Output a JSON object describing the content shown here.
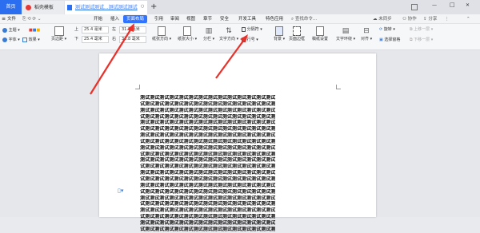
{
  "tabs": [
    {
      "label": "首页",
      "active": true
    },
    {
      "label": "稻壳模板",
      "active": false
    },
    {
      "label": "测试测试测试...测试测试测试",
      "active": false
    }
  ],
  "new_tab": "+",
  "window_controls": {
    "minimize": "—",
    "maximize": "□",
    "close": "✕"
  },
  "menu": {
    "file": "文件",
    "items": [
      "开始",
      "插入",
      "页面布局",
      "引用",
      "审阅",
      "视图",
      "章节",
      "安全",
      "开发工具",
      "特色应用"
    ],
    "search": "查找命令...",
    "account": "未同步",
    "collab": "协作",
    "share": "分享"
  },
  "ribbon": {
    "theme": "主题",
    "font": "字体",
    "effect": "效果",
    "margin": "页边距",
    "top_label": "上",
    "bottom_label": "下",
    "left_label": "左",
    "right_label": "右",
    "top_value": "25.4 毫米",
    "bottom_value": "25.4 毫米",
    "left_value": "31.8 毫米",
    "right_value": "31.8 毫米",
    "orientation": "纸张方向",
    "size": "纸张大小",
    "columns": "分栏",
    "text_direction": "文字方向",
    "line_numbers": "行号",
    "breaks": "分隔符",
    "background": "背景",
    "page_border": "页面边框",
    "paper_settings": "稿纸设置",
    "wrap_text": "文字环绕",
    "align": "对齐",
    "rotate": "旋转",
    "selection_pane": "选择窗格",
    "bring_forward": "上移一层",
    "send_backward": "下移一层"
  },
  "document": {
    "lines": [
      "测试测试测试测试测试测试测试测试测试测试测试测试测试测试",
      "试测试测试测试测试测试测试测试测试测试测试测试测试测试测",
      "测试测试测试测试测试测试测试测试测试测试测试测试测试测试",
      "试测试测试测试测试测试测试测试测试测试测试测试测试测试测",
      "测试测试测试测试测试测试测试测试测试测试测试测试测试测试",
      "试测试测试测试测试测试测试测试测试测试测试测试测试测试测",
      "测试测试测试测试测试测试测试测试测试测试测试测试测试测试",
      "试测试测试测试测试测试测试测试测试测试测试测试测试测试测",
      "测试测试测试测试测试测试测试测试测试测试测试测试测试测试",
      "试测试测试测试测试测试测试测试测试测试测试测试测试测试测",
      "测试测试测试测试测试测试测试测试测试测试测试测试测试测试",
      "试测试测试测试测试测试测试测试测试测试测试测试测试测试测",
      "测试测试测试测试测试测试测试测试测试测试测试测试测试测试",
      "试测试测试测试测试测试测试测试测试测试测试测试测试测试测",
      "测试测试测试测试测试测试测试测试测试测试测试测试测试测试",
      "试测试测试测试测试测试测试测试测试测试测试测试测试测试测",
      "测试测试测试测试测试测试测试测试测试测试测试测试测试测试",
      "试测试测试测试测试测试测试测试测试测试测试测试测试测试测",
      "测试测试测试测试测试测试测试测试测试测试测试测试测试测试",
      "试测试测试测试测试测试测试测试测试测试测试测试测试测试测",
      "测试测试测试测试测试测试测试测试测试测试测试测试测试测试",
      "试测试测试测试测试测试测试测试测试测试测试测试测试测试测"
    ]
  },
  "colors": {
    "accent": "#2f73ff",
    "arrow": "#e8312a",
    "tab_active": "#2b6ff0"
  }
}
